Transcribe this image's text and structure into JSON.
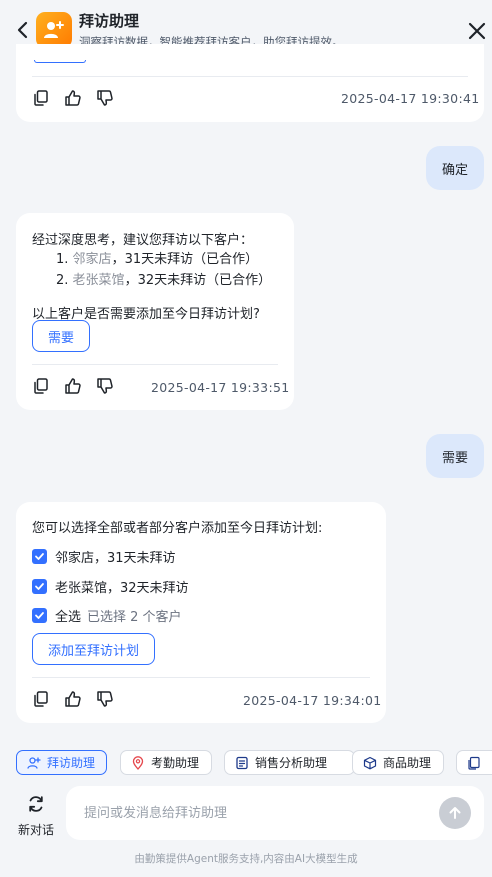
{
  "header": {
    "title": "拜访助理",
    "subtitle": "洞察拜访数据，智能推荐拜访客户，助您拜访提效。"
  },
  "messages": {
    "m1": {
      "time": "2025-04-17 19:30:41"
    },
    "u1": {
      "text": "确定"
    },
    "m2": {
      "intro": "经过深度思考，建议您拜访以下客户：",
      "items": [
        {
          "num": "1.",
          "name": "邻家店",
          "detail": "，31天未拜访（已合作）"
        },
        {
          "num": "2.",
          "name": "老张菜馆",
          "detail": "，32天未拜访（已合作）"
        }
      ],
      "question": "以上客户是否需要添加至今日拜访计划?",
      "button": "需要",
      "time": "2025-04-17 19:33:51"
    },
    "u2": {
      "text": "需要"
    },
    "m3": {
      "intro": "您可以选择全部或者部分客户添加至今日拜访计划:",
      "options": [
        {
          "label": "邻家店，31天未拜访",
          "checked": true
        },
        {
          "label": "老张菜馆，32天未拜访",
          "checked": true
        }
      ],
      "select_all": "全选",
      "selected_text": "已选择 2 个客户",
      "button": "添加至拜访计划",
      "time": "2025-04-17 19:34:01"
    }
  },
  "chips": [
    {
      "label": "拜访助理",
      "icon": "user-add-icon",
      "active": true
    },
    {
      "label": "考勤助理",
      "icon": "location-pin-icon",
      "active": false
    },
    {
      "label": "销售分析助理",
      "icon": "document-chart-icon",
      "active": false
    },
    {
      "label": "商品助理",
      "icon": "box-icon",
      "active": false
    }
  ],
  "composer": {
    "new_chat": "新对话",
    "placeholder": "提问或发消息给拜访助理"
  },
  "footer": "由勤策提供Agent服务支持,内容由AI大模型生成",
  "colors": {
    "accent": "#3370ff",
    "user_bubble": "#dce8fb",
    "logo": "#ff9500"
  }
}
